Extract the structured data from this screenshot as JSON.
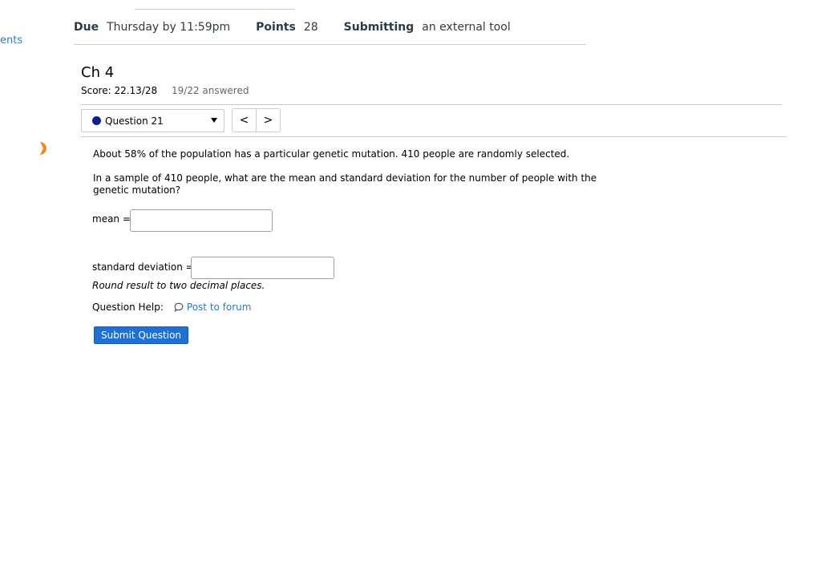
{
  "sidebar": {
    "partial_label": "ents"
  },
  "assignment_meta": {
    "due_label": "Due",
    "due_value": "Thursday by 11:59pm",
    "points_label": "Points",
    "points_value": "28",
    "submitting_label": "Submitting",
    "submitting_value": "an external tool"
  },
  "quiz": {
    "title": "Ch 4",
    "score": "Score: 22.13/28",
    "answered": "19/22 answered",
    "question_selector": "Question 21",
    "prev_label": "<",
    "next_label": ">"
  },
  "question": {
    "line1": "About 58% of the population has a particular genetic mutation. 410 people are randomly selected.",
    "line2": "In a sample of 410 people, what are the mean and standard deviation for the number of people with the genetic mutation?",
    "mean_label": "mean =",
    "mean_value": "",
    "sd_label": "standard deviation =",
    "sd_value": "",
    "round_note": "Round result to two decimal places.",
    "help_label": "Question Help:",
    "forum_link": "Post to forum",
    "submit_label": "Submit Question"
  },
  "colors": {
    "accent": "#1e70d2",
    "link": "#2d7bc0",
    "status_dot": "#0a1e8c",
    "orange": "#f08a24"
  }
}
